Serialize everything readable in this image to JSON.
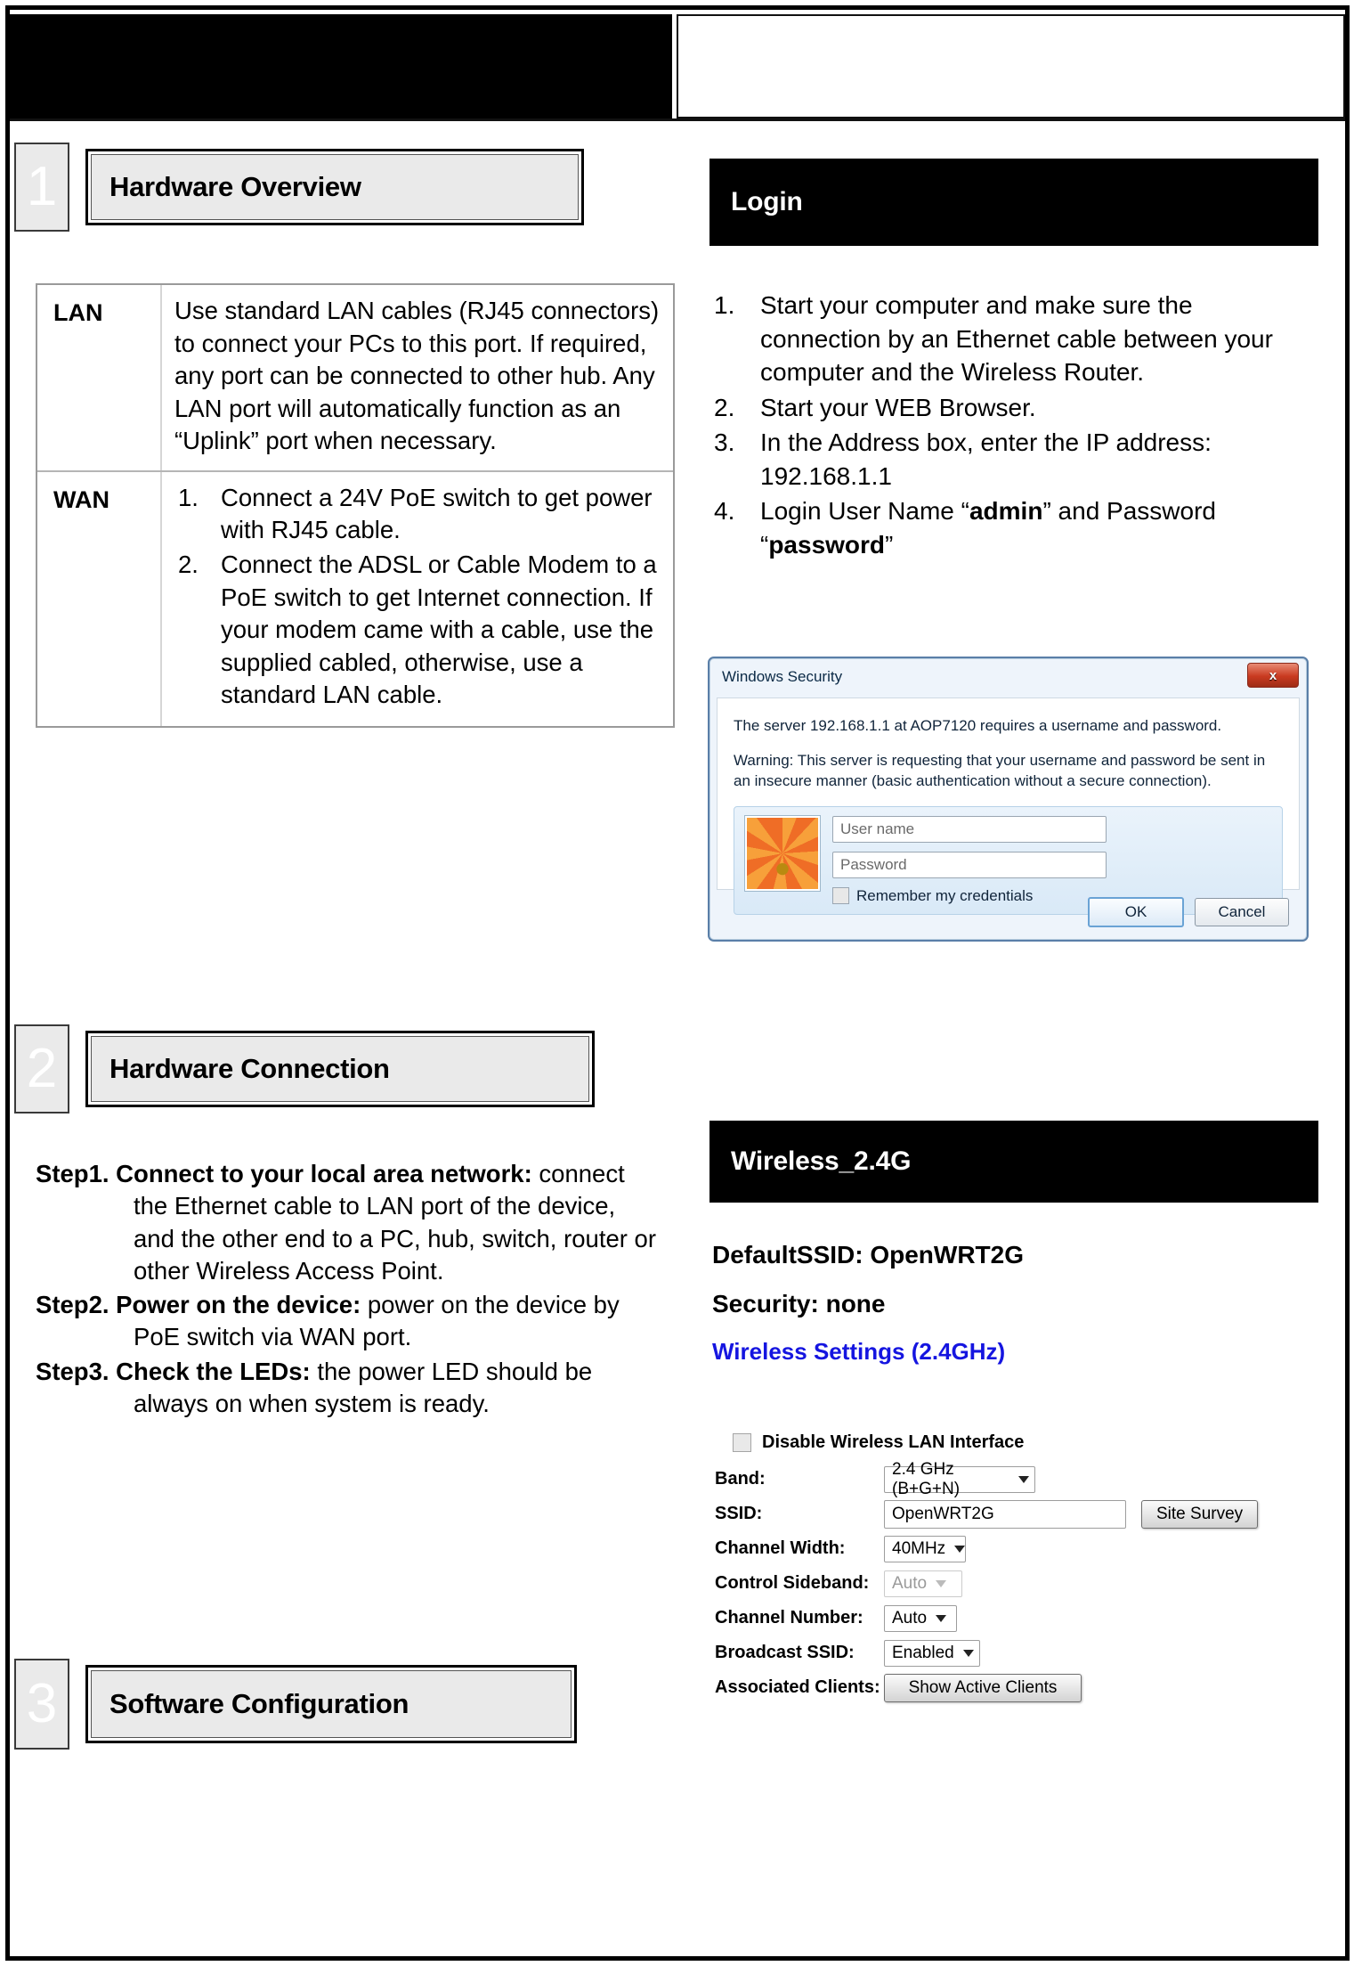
{
  "sections": [
    {
      "number": "1",
      "title": "Hardware Overview"
    },
    {
      "number": "2",
      "title": "Hardware Connection"
    },
    {
      "number": "3",
      "title": "Software Configuration"
    }
  ],
  "hardware_overview": {
    "rows": [
      {
        "label": "LAN",
        "text": "Use standard LAN cables (RJ45 connectors) to connect your PCs to this port. If required, any port can be connected to other hub. Any LAN port will automatically function as an “Uplink” port when necessary."
      },
      {
        "label": "WAN",
        "items": [
          {
            "num": "1.",
            "text": "Connect a 24V PoE switch to get power with RJ45 cable."
          },
          {
            "num": "2.",
            "text": "Connect the ADSL or Cable Modem to a PoE switch to get Internet connection. If your modem came with a cable, use the supplied cabled, otherwise, use a standard LAN cable."
          }
        ]
      }
    ]
  },
  "hardware_connection": {
    "steps": [
      {
        "label": "Step1. Connect to your local area network:",
        "text": " connect the Ethernet cable to LAN port of the device, and the other end to a PC, hub, switch, router or other Wireless Access Point."
      },
      {
        "label": "Step2. Power on the device:",
        "text": " power on the device by PoE switch via WAN port."
      },
      {
        "label": "Step3. Check the LEDs:",
        "text": " the power LED should be always on when system is ready."
      }
    ]
  },
  "login": {
    "heading": "Login",
    "steps": [
      {
        "num": "1.",
        "text": "Start your computer and make sure the connection by an Ethernet cable between your computer and the Wireless Router."
      },
      {
        "num": "2.",
        "text": "Start your WEB Browser."
      },
      {
        "num": "3.",
        "text": "In the Address box, enter the IP address: 192.168.1.1"
      },
      {
        "num": "4.",
        "pre": "Login User Name “",
        "bold1": "admin",
        "mid": "” and Password “",
        "bold2": "password",
        "post": "”"
      }
    ]
  },
  "windows_security": {
    "title": "Windows Security",
    "close_label": "x",
    "message1": "The server 192.168.1.1 at AOP7120 requires a username and password.",
    "message2": "Warning: This server is requesting that your username and password be sent in an insecure manner (basic authentication without a secure connection).",
    "username_placeholder": "User name",
    "password_placeholder": "Password",
    "remember_label": "Remember my credentials",
    "ok_label": "OK",
    "cancel_label": "Cancel"
  },
  "wireless": {
    "heading": "Wireless_2.4G",
    "default_ssid": "DefaultSSID: OpenWRT2G",
    "security": "Security: none",
    "settings_link": "Wireless Settings (2.4GHz)",
    "link_color": "#1515e0",
    "form": {
      "disable_label": "Disable Wireless LAN Interface",
      "band_label": "Band:",
      "band_value": "2.4 GHz (B+G+N)",
      "ssid_label": "SSID:",
      "ssid_value": "OpenWRT2G",
      "site_survey_label": "Site Survey",
      "channel_width_label": "Channel Width:",
      "channel_width_value": "40MHz",
      "control_sideband_label": "Control Sideband:",
      "control_sideband_value": "Auto",
      "channel_number_label": "Channel Number:",
      "channel_number_value": "Auto",
      "broadcast_ssid_label": "Broadcast SSID:",
      "broadcast_ssid_value": "Enabled",
      "associated_clients_label": "Associated Clients:",
      "show_active_clients_label": "Show Active Clients"
    }
  }
}
